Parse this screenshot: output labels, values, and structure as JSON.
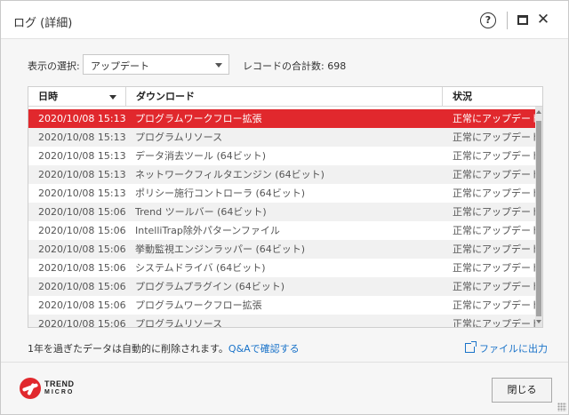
{
  "window": {
    "title": "ログ (詳細)",
    "help_glyph": "?",
    "close_glyph": "✕"
  },
  "filter": {
    "label": "表示の選択:",
    "selected": "アップデート",
    "total": "レコードの合計数: 698"
  },
  "table": {
    "columns": [
      "日時",
      "ダウンロード",
      "状況"
    ],
    "rows": [
      {
        "date": "2020/10/08 15:13",
        "item": "プログラムワークフロー拡張",
        "status": "正常にアップデート",
        "selected": true
      },
      {
        "date": "2020/10/08 15:13",
        "item": "プログラムリソース",
        "status": "正常にアップデート"
      },
      {
        "date": "2020/10/08 15:13",
        "item": "データ消去ツール (64ビット)",
        "status": "正常にアップデート"
      },
      {
        "date": "2020/10/08 15:13",
        "item": "ネットワークフィルタエンジン (64ビット)",
        "status": "正常にアップデート"
      },
      {
        "date": "2020/10/08 15:13",
        "item": "ポリシー施行コントローラ (64ビット)",
        "status": "正常にアップデート"
      },
      {
        "date": "2020/10/08 15:06",
        "item": "Trend ツールバー (64ビット)",
        "status": "正常にアップデート"
      },
      {
        "date": "2020/10/08 15:06",
        "item": "IntelliTrap除外パターンファイル",
        "status": "正常にアップデート"
      },
      {
        "date": "2020/10/08 15:06",
        "item": "挙動監視エンジンラッパー (64ビット)",
        "status": "正常にアップデート"
      },
      {
        "date": "2020/10/08 15:06",
        "item": "システムドライバ (64ビット)",
        "status": "正常にアップデート"
      },
      {
        "date": "2020/10/08 15:06",
        "item": "プログラムプラグイン (64ビット)",
        "status": "正常にアップデート"
      },
      {
        "date": "2020/10/08 15:06",
        "item": "プログラムワークフロー拡張",
        "status": "正常にアップデート"
      },
      {
        "date": "2020/10/08 15:06",
        "item": "プログラムリソース",
        "status": "正常にアップデート"
      }
    ]
  },
  "footer": {
    "note": "1年を過ぎたデータは自動的に削除されます。",
    "link": "Q&Aで確認する",
    "export": "ファイルに出力",
    "close": "閉じる"
  },
  "brand": {
    "line1": "TREND",
    "line2": "MICRO",
    "color": "#e1282d"
  },
  "colors": {
    "selected_row": "#e1282d",
    "link": "#1a73c9"
  }
}
